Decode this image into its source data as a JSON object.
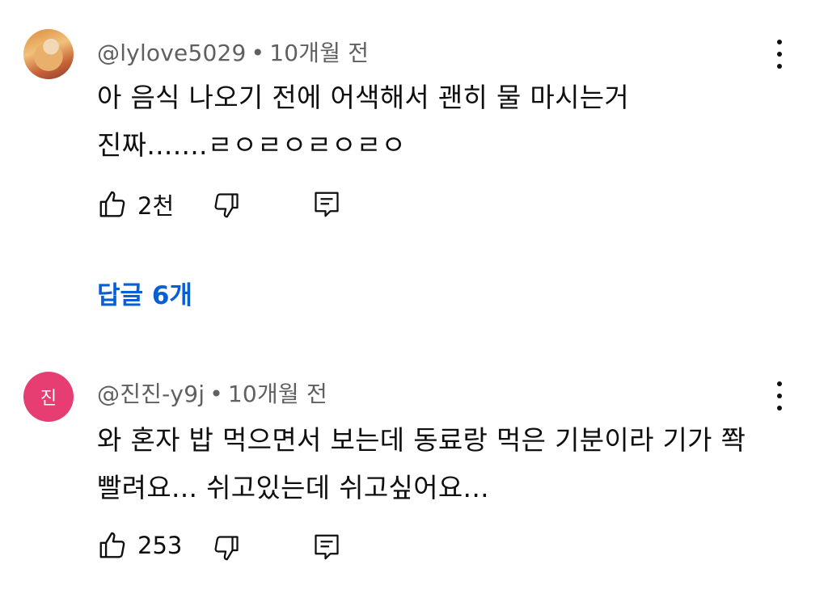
{
  "comments": [
    {
      "author": "@lylove5029",
      "separator": "•",
      "time": "10개월 전",
      "text_lines": [
        "아 음식 나오기 전에 어색해서 괜히 물 마시는거",
        "진짜.......ㄹㅇㄹㅇㄹㅇㄹㅇ"
      ],
      "likes": "2천",
      "replies_label": "답글 6개",
      "avatar_icon": "profile-photo"
    },
    {
      "author": "@진진-y9j",
      "separator": "•",
      "time": "10개월 전",
      "text_lines": [
        "와  혼자 밥 먹으면서 보는데 동료랑 먹은 기분이라 기가 쫙",
        "빨려요... 쉬고있는데 쉬고싶어요..."
      ],
      "likes": "253",
      "avatar_letter": "진",
      "avatar_color": "#e63d72"
    }
  ],
  "icons": {
    "like": "thumbs-up-icon",
    "dislike": "thumbs-down-icon",
    "reply": "comment-reply-icon",
    "more": "kebab-menu-icon"
  },
  "colors": {
    "link": "#065fd4",
    "meta": "#606060",
    "text": "#0f0f0f"
  }
}
